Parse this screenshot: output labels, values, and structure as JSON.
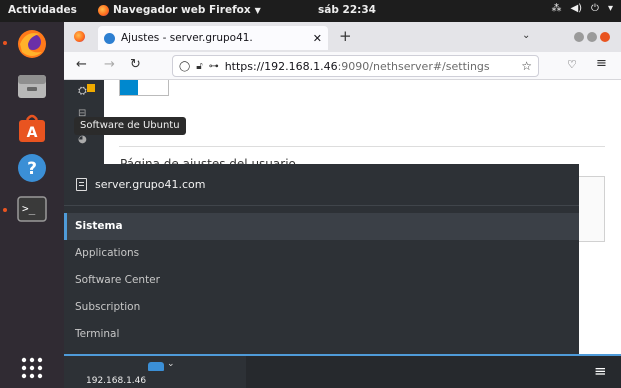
{
  "topbar": {
    "activities": "Actividades",
    "app_name": "Navegador web Firefox",
    "clock": "sáb 22:34"
  },
  "dock": {
    "tooltip": "Software de Ubuntu"
  },
  "browser": {
    "tab_title": "Ajustes - server.grupo41.",
    "url_host": "https://192.168.1.46",
    "url_path": ":9090/nethserver#/settings",
    "new_tab_label": "+"
  },
  "page": {
    "heading_partial": "Página de ajustes del usuario"
  },
  "nav": {
    "server_name": "server.grupo41.com",
    "items": [
      {
        "label": "Sistema",
        "active": true
      },
      {
        "label": "Applications",
        "active": false
      },
      {
        "label": "Software Center",
        "active": false
      },
      {
        "label": "Subscription",
        "active": false
      },
      {
        "label": "Terminal",
        "active": false
      }
    ],
    "host_ip": "192.168.1.46"
  },
  "colors": {
    "accent": "#4f9bd9",
    "ubuntu_orange": "#e95420"
  }
}
